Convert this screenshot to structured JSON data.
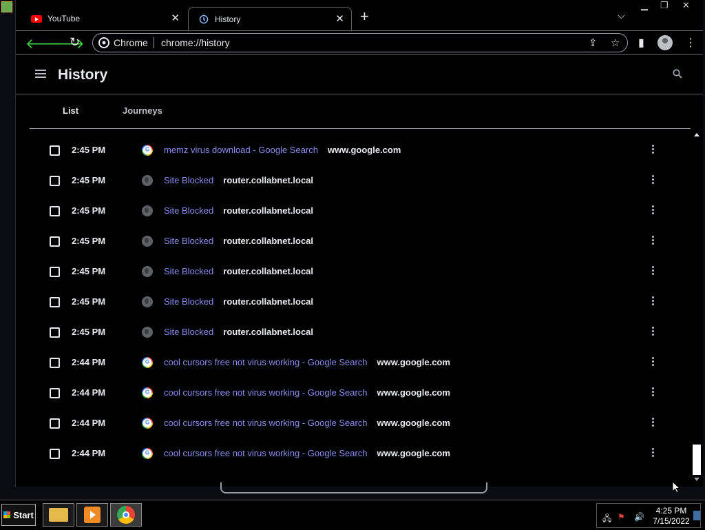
{
  "browser": {
    "tabs": [
      {
        "label": "YouTube",
        "icon": "youtube-icon",
        "active": false
      },
      {
        "label": "History",
        "icon": "history-icon",
        "active": true
      }
    ],
    "omnibox": {
      "chip_label": "Chrome",
      "url": "chrome://history"
    }
  },
  "history_page": {
    "title": "History",
    "tabs": [
      {
        "label": "List",
        "active": true
      },
      {
        "label": "Journeys",
        "active": false
      }
    ],
    "entries": [
      {
        "time": "2:45 PM",
        "favicon": "google",
        "title": "memz virus download - Google Search",
        "domain": "www.google.com"
      },
      {
        "time": "2:45 PM",
        "favicon": "globe",
        "title": "Site Blocked",
        "domain": "router.collabnet.local"
      },
      {
        "time": "2:45 PM",
        "favicon": "globe",
        "title": "Site Blocked",
        "domain": "router.collabnet.local"
      },
      {
        "time": "2:45 PM",
        "favicon": "globe",
        "title": "Site Blocked",
        "domain": "router.collabnet.local"
      },
      {
        "time": "2:45 PM",
        "favicon": "globe",
        "title": "Site Blocked",
        "domain": "router.collabnet.local"
      },
      {
        "time": "2:45 PM",
        "favicon": "globe",
        "title": "Site Blocked",
        "domain": "router.collabnet.local"
      },
      {
        "time": "2:45 PM",
        "favicon": "globe",
        "title": "Site Blocked",
        "domain": "router.collabnet.local"
      },
      {
        "time": "2:44 PM",
        "favicon": "google",
        "title": "cool cursors free not virus working - Google Search",
        "domain": "www.google.com"
      },
      {
        "time": "2:44 PM",
        "favicon": "google",
        "title": "cool cursors free not virus working - Google Search",
        "domain": "www.google.com"
      },
      {
        "time": "2:44 PM",
        "favicon": "google",
        "title": "cool cursors free not virus working - Google Search",
        "domain": "www.google.com"
      },
      {
        "time": "2:44 PM",
        "favicon": "google",
        "title": "cool cursors free not virus working - Google Search",
        "domain": "www.google.com"
      }
    ]
  },
  "taskbar": {
    "start_label": "Start",
    "clock_time": "4:25 PM",
    "clock_date": "7/15/2022"
  },
  "colors": {
    "link": "#8c8cf0",
    "background": "#000000",
    "text": "#e8eaed",
    "nav_arrows": "#3fdc3f"
  }
}
